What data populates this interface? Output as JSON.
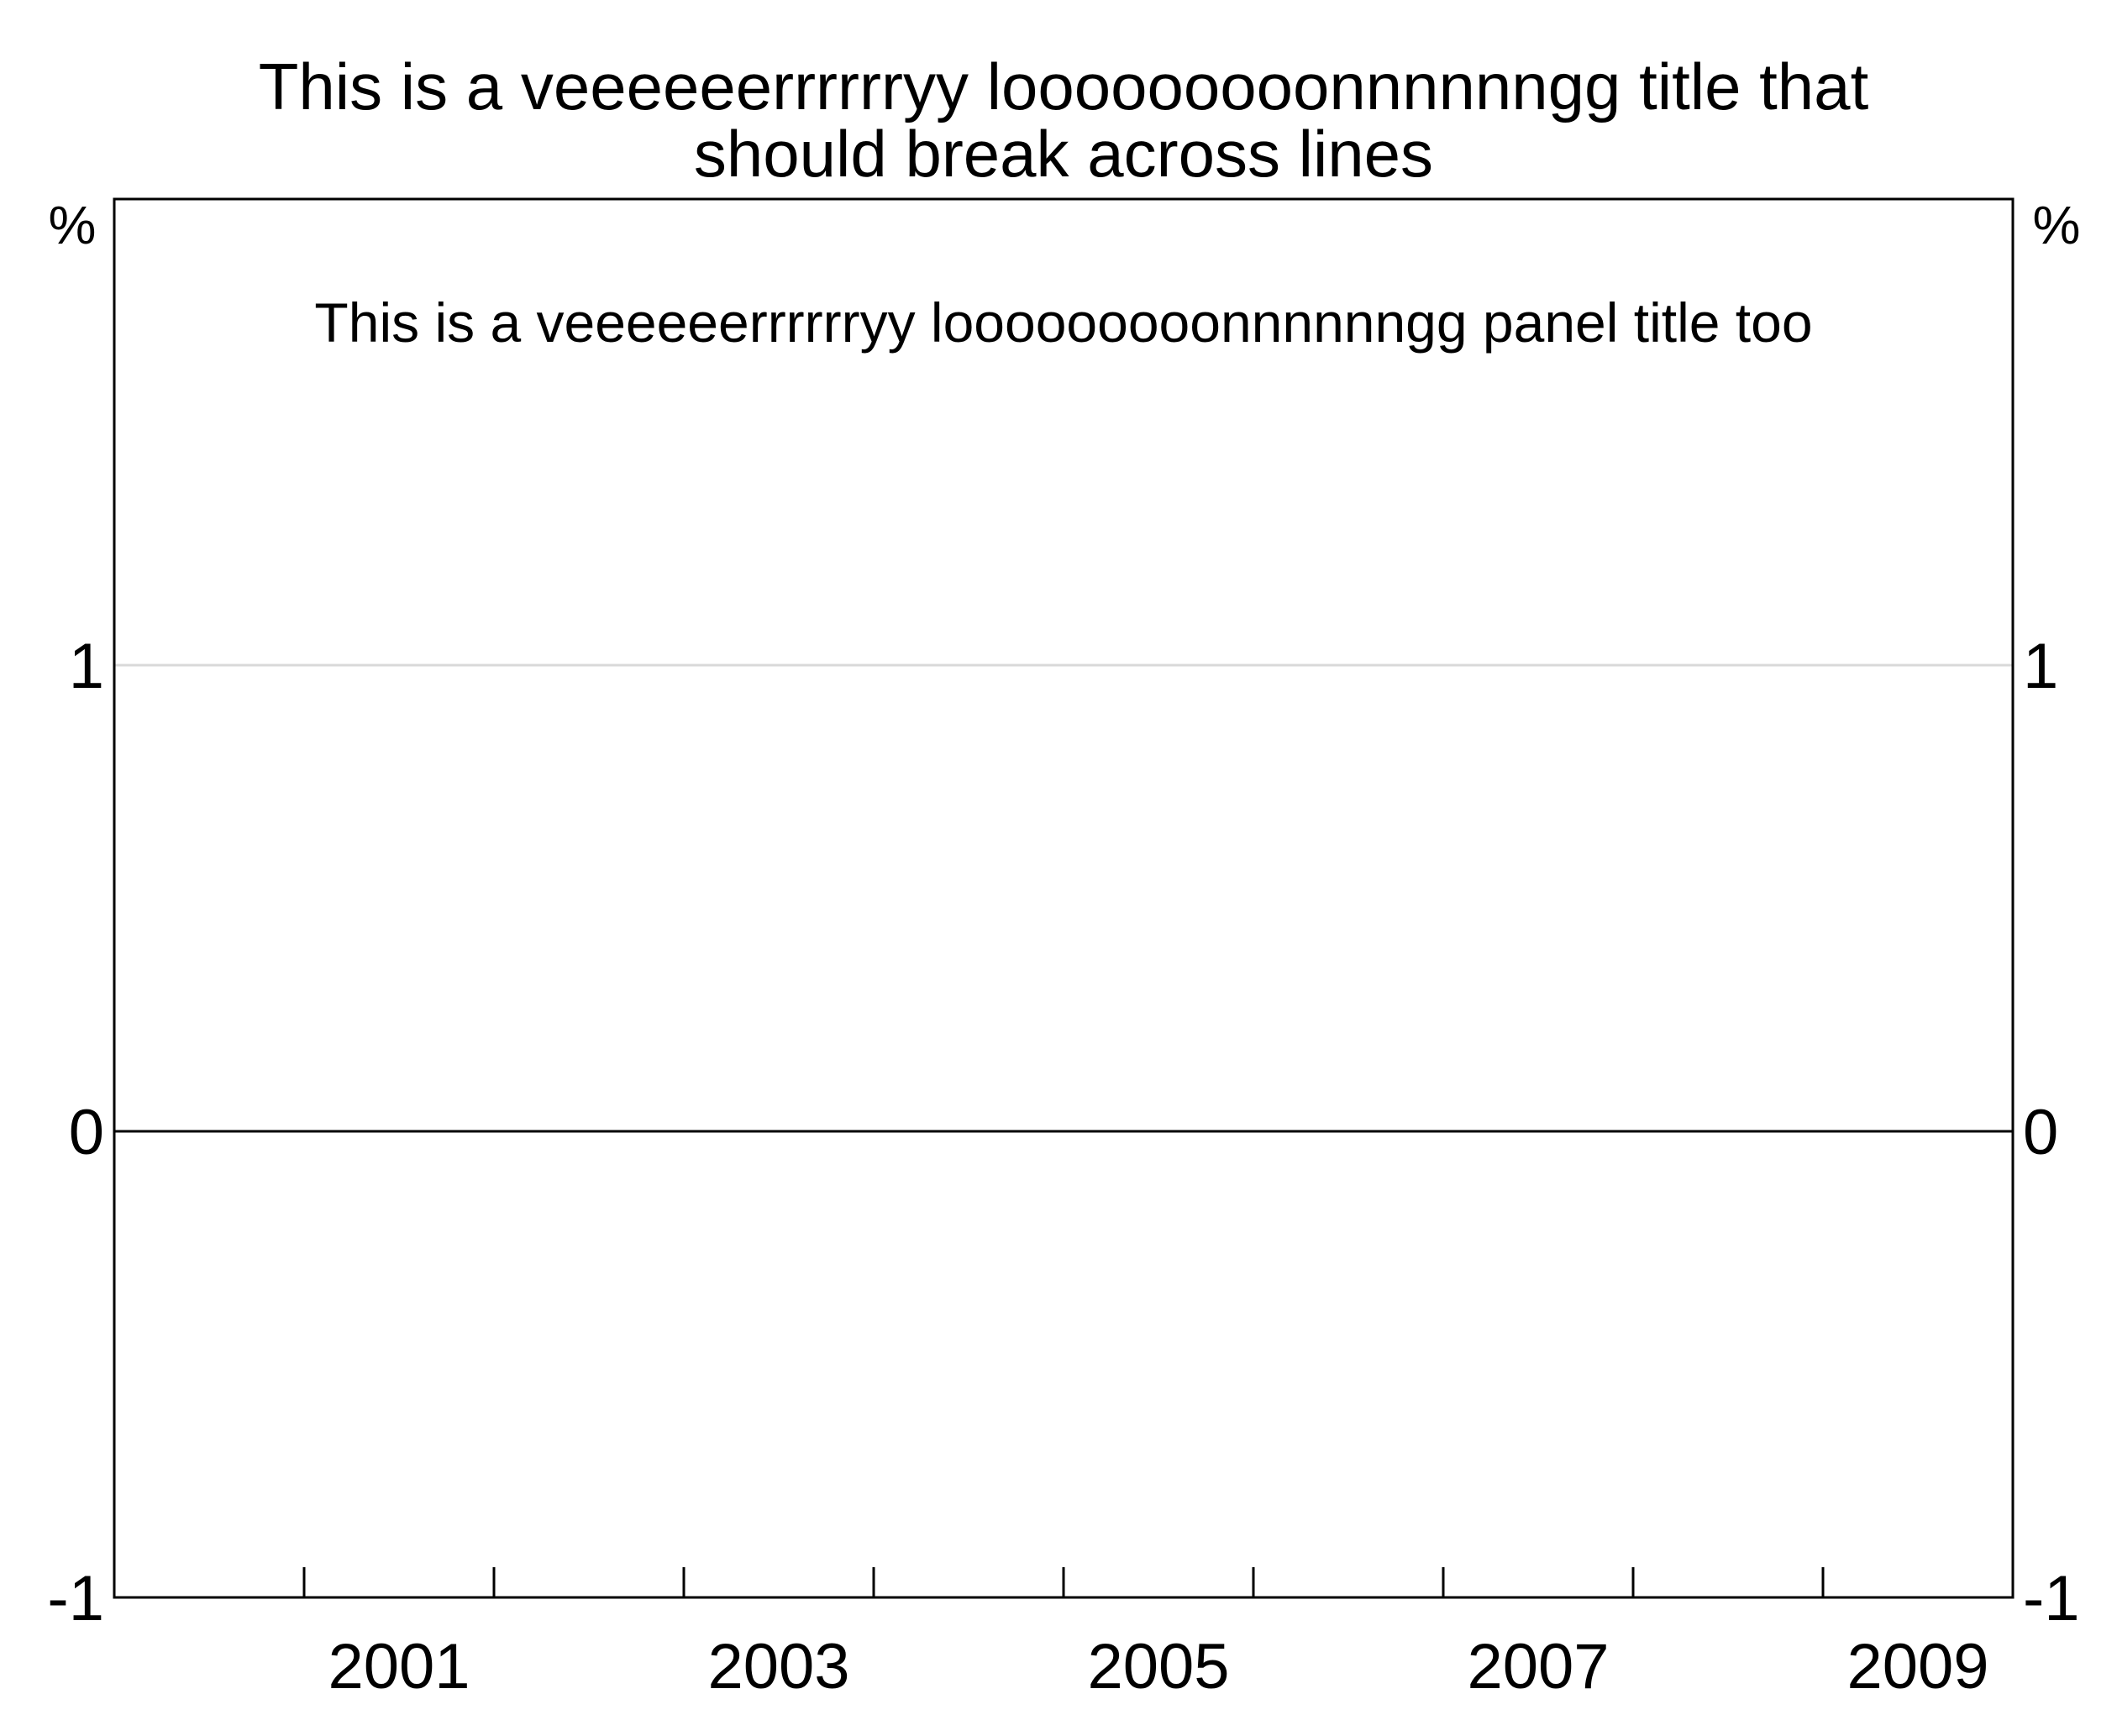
{
  "chart_data": {
    "type": "line",
    "title_lines": [
      "This is a veeeeeerrrrrryy looooooooonnnnnngg title that",
      "should break across lines"
    ],
    "panel_title": "This is a veeeeeerrrrrryy looooooooonnnnnngg panel title too",
    "y_unit_left": "%",
    "y_unit_right": "%",
    "ylim": [
      -1,
      2
    ],
    "yticks": [
      "-1",
      "0",
      "1"
    ],
    "ytick_values": [
      -1,
      0,
      1
    ],
    "xlim": [
      2000,
      2010
    ],
    "xtick_values": [
      2001,
      2002,
      2003,
      2004,
      2005,
      2006,
      2007,
      2008,
      2009
    ],
    "xlabels": [
      {
        "label": "2001",
        "center": 2001.5
      },
      {
        "label": "2003",
        "center": 2003.5
      },
      {
        "label": "2005",
        "center": 2005.5
      },
      {
        "label": "2007",
        "center": 2007.5
      },
      {
        "label": "2009",
        "center": 2009.5
      }
    ],
    "gridlines": true,
    "zero_line": true,
    "series": []
  },
  "colors": {
    "background": "#ffffff",
    "axis": "#000000",
    "grid": "#d9d9d9",
    "text": "#000000"
  }
}
